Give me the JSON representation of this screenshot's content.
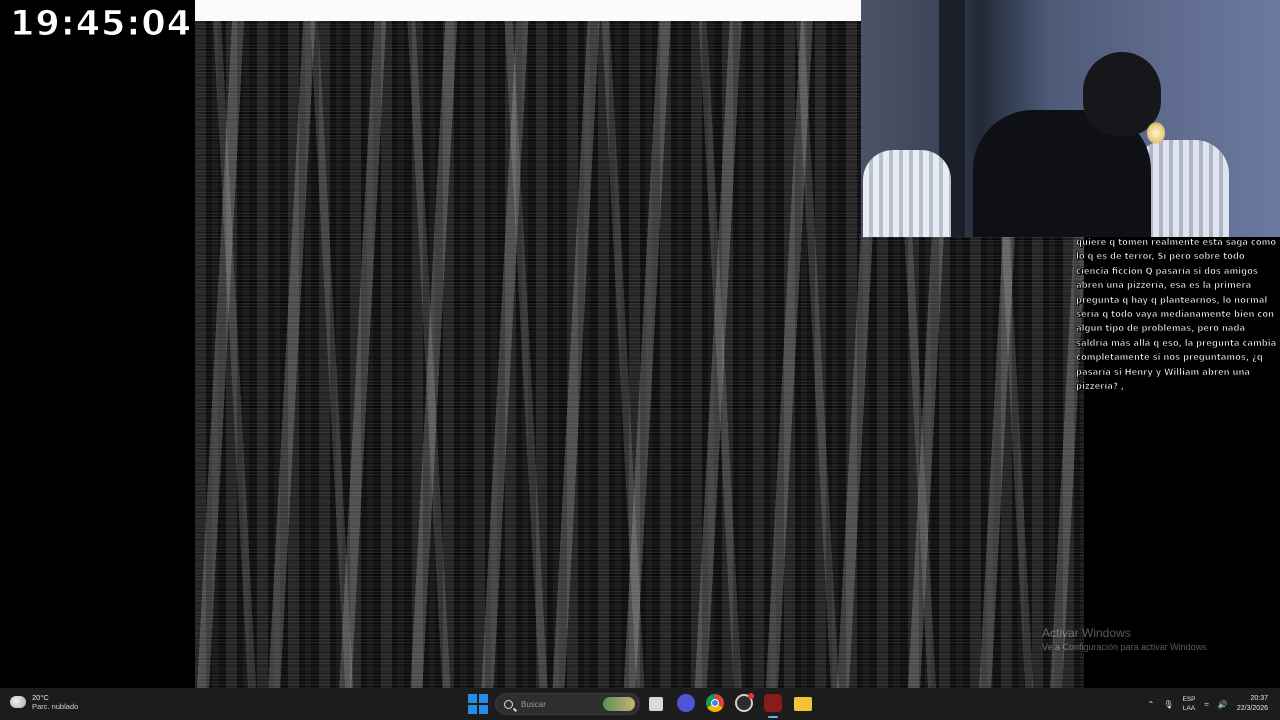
{
  "overlay": {
    "clock": "19:45:04"
  },
  "stream": {
    "caption": "quiere q tomen realmente está saga como lo q es de terror, Sí pero sobre todo ciencia ficción Q pasaría si dos amigos abren una pizzería, esa es la primera pregunta q hay q plantearnos, lo normal sería q todo vaya medianamente bien con algún tipo de problemas, pero nada saldría más allá q eso, la pregunta cambia completamente si nos preguntamos, ¿q pasaría si Henry y William abren una pizzería? ,"
  },
  "watermark": {
    "title": "Activar Windows",
    "subtitle": "Ve a Configuración para activar Windows."
  },
  "taskbar": {
    "weather_temp": "20°C",
    "weather_desc": "Parc. nublado",
    "search_placeholder": "Buscar",
    "tray_lang_top": "ESP",
    "tray_lang_bottom": "LAA",
    "tray_time": "20:37",
    "tray_date": "22/3/2026",
    "icons": {
      "chevron": "chevron-up-icon",
      "mic": "microphone-icon",
      "wifi": "wifi-icon",
      "volume": "volume-icon"
    }
  },
  "colors": {
    "accent": "#2a8be6",
    "taskbar_bg": "#1c1c1c",
    "recording": "#e53935"
  }
}
